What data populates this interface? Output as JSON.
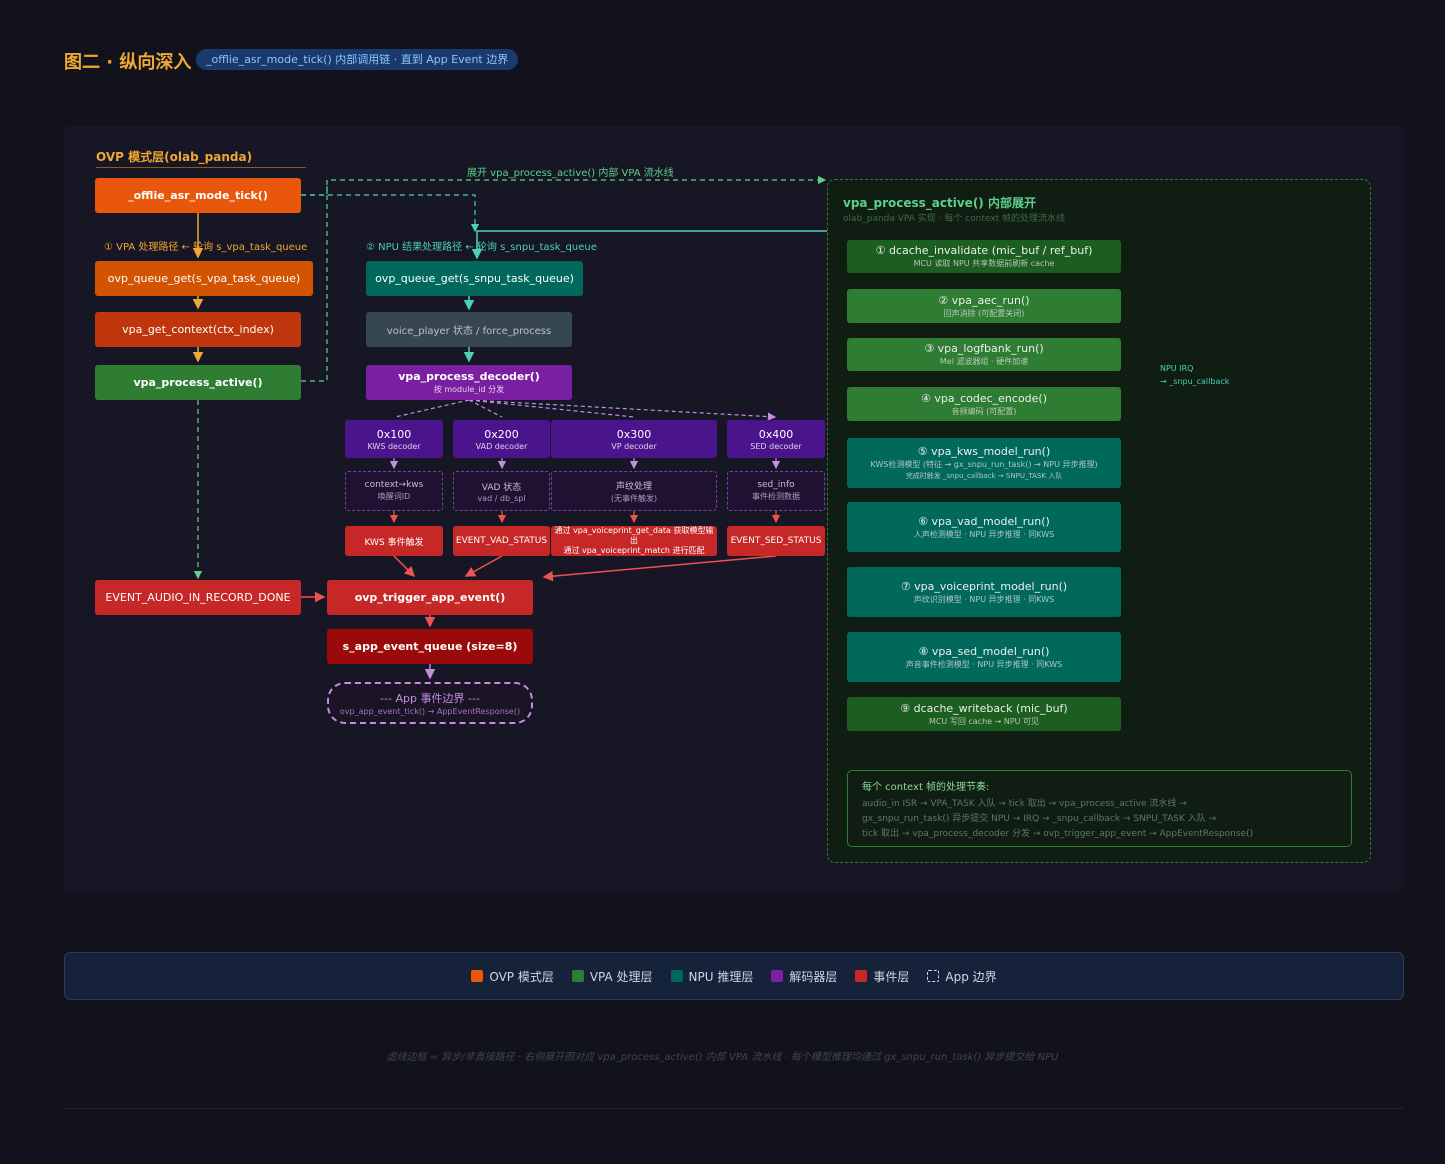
{
  "title": "图二 · 纵向深入",
  "subtitle": "_offlie_asr_mode_tick() 内部调用链 · 直到 App Event 边界",
  "left": {
    "layer_label": "OVP 模式层(olab_panda)",
    "mode_tick": "_offlie_asr_mode_tick()",
    "path1_label": "① VPA 处理路径 ← 轮询 s_vpa_task_queue",
    "queue_get_vpa": "ovp_queue_get(s_vpa_task_queue)",
    "get_context": "vpa_get_context(ctx_index)",
    "process_active": "vpa_process_active()",
    "path2_label": "② NPU 结果处理路径 ← 轮询 s_snpu_task_queue",
    "queue_get_snpu": "ovp_queue_get(s_snpu_task_queue)",
    "voice_player": "voice_player 状态 / force_process",
    "decoder": "vpa_process_decoder()",
    "decoder_sub": "按 module_id 分发",
    "expand_label": "展开 vpa_process_active() 内部 VPA 流水线",
    "decoders": [
      {
        "id": "0x100",
        "name": "KWS decoder",
        "state": "context→kws",
        "state_sub": "唤醒词ID",
        "event": "KWS 事件触发"
      },
      {
        "id": "0x200",
        "name": "VAD decoder",
        "state": "VAD 状态",
        "state_sub": "vad / db_spl",
        "event": "EVENT_VAD_STATUS"
      },
      {
        "id": "0x300",
        "name": "VP decoder",
        "state": "声纹处理",
        "state_sub": "(无事件触发)",
        "event": "通过 vpa_voiceprint_get_data 获取模型输出",
        "event2": "通过 vpa_voiceprint_match 进行匹配"
      },
      {
        "id": "0x400",
        "name": "SED decoder",
        "state": "sed_info",
        "state_sub": "事件检测数据",
        "event": "EVENT_SED_STATUS"
      }
    ],
    "audio_done": "EVENT_AUDIO_IN_RECORD_DONE",
    "trigger": "ovp_trigger_app_event()",
    "event_queue": "s_app_event_queue (size=8)",
    "boundary_title": "--- App 事件边界 ---",
    "boundary_sub": "ovp_app_event_tick() → AppEventResponse()"
  },
  "right": {
    "title": "vpa_process_active() 内部展开",
    "subtitle": "olab_panda VPA 实现 · 每个 context 帧的处理流水线",
    "npu_irq": "NPU IRQ",
    "npu_irq2": "→ _snpu_callback",
    "steps": [
      {
        "t": "① dcache_invalidate (mic_buf / ref_buf)",
        "s": "MCU 读取 NPU 共享数据前刷新 cache"
      },
      {
        "t": "② vpa_aec_run()",
        "s": "回声消除 (可配置关闭)"
      },
      {
        "t": "③ vpa_logfbank_run()",
        "s": "Mel 滤波器组 · 硬件加速"
      },
      {
        "t": "④ vpa_codec_encode()",
        "s": "音频编码 (可配置)"
      },
      {
        "t": "⑤ vpa_kws_model_run()",
        "s": "KWS检测模型 (特征 → gx_snpu_run_task() → NPU 异步推理)",
        "s2": "完成时触发 _snpu_callback → SNPU_TASK 入队"
      },
      {
        "t": "⑥ vpa_vad_model_run()",
        "s": "人声检测模型 · NPU 异步推理 · 同KWS"
      },
      {
        "t": "⑦ vpa_voiceprint_model_run()",
        "s": "声纹识别模型 · NPU 异步推理 · 同KWS"
      },
      {
        "t": "⑧ vpa_sed_model_run()",
        "s": "声音事件检测模型 · NPU 异步推理 · 同KWS"
      },
      {
        "t": "⑨ dcache_writeback (mic_buf)",
        "s": "MCU 写回 cache → NPU 可见"
      }
    ],
    "summary_title": "每个 context 帧的处理节奏:",
    "summary_lines": [
      "audio_in ISR → VPA_TASK 入队 → tick 取出 → vpa_process_active 流水线 →",
      "gx_snpu_run_task() 异步提交 NPU → IRQ → _snpu_callback → SNPU_TASK 入队 →",
      "tick 取出 → vpa_process_decoder 分发 → ovp_trigger_app_event → AppEventResponse()"
    ]
  },
  "legend": [
    {
      "label": "OVP 模式层",
      "color": "#e8570c"
    },
    {
      "label": "VPA 处理层",
      "color": "#2e7d32"
    },
    {
      "label": "NPU 推理层",
      "color": "#00695c"
    },
    {
      "label": "解码器层",
      "color": "#7b1fa2"
    },
    {
      "label": "事件层",
      "color": "#c62828"
    },
    {
      "label": "App 边界",
      "color": "dashed"
    }
  ],
  "footer": "虚线边框 = 异步/非直接路径 · 右侧展开图对应 vpa_process_active() 内部 VPA 流水线 · 每个模型推理均通过 gx_snpu_run_task() 异步提交给 NPU"
}
